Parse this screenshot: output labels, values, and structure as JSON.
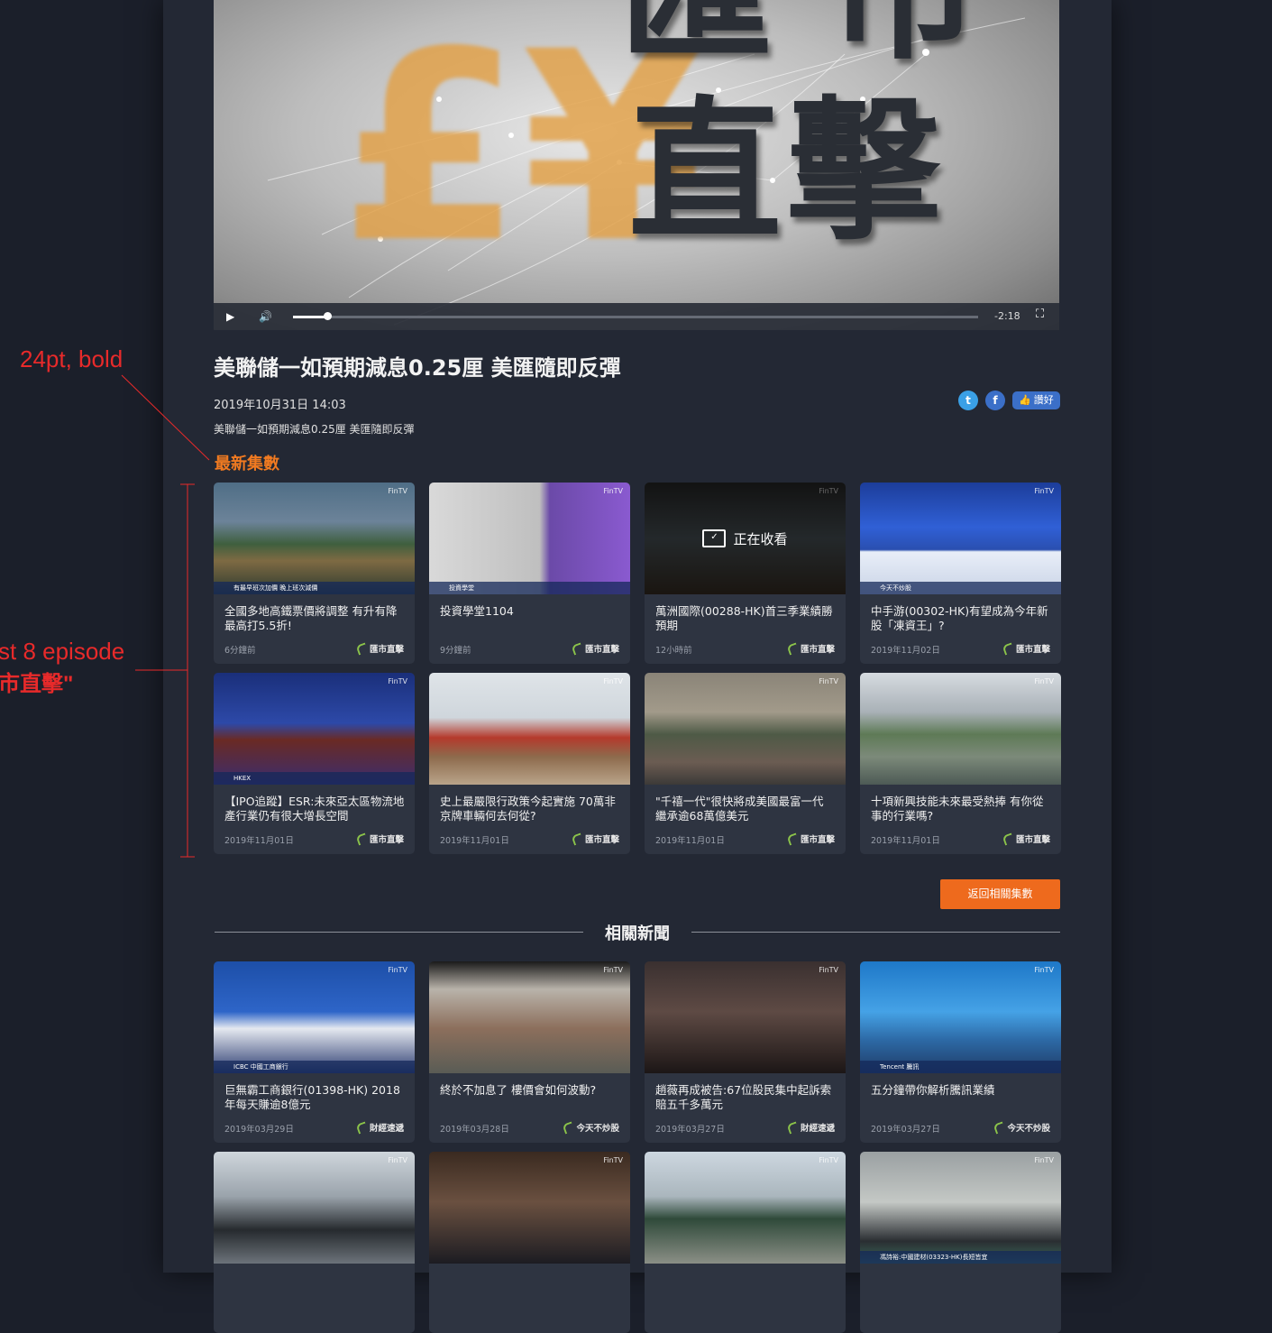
{
  "video": {
    "headline_top": "匯市",
    "headline_bottom": "直擊",
    "currency_symbol": "£¥",
    "time": "-2:18",
    "progress": 0.05
  },
  "article": {
    "title": "美聯儲一如預期減息0.25厘 美匯隨即反彈",
    "date": "2019年10月31日 14:03",
    "description": "美聯儲一如預期減息0.25厘 美匯隨即反彈",
    "like_label": "讚好"
  },
  "latest": {
    "heading": "最新集數",
    "items": [
      {
        "title": "全國多地高鐵票價將調整 有升有降最高打5.5折!",
        "time": "6分鐘前",
        "program": "匯市直擊",
        "thumb_text": "有最早班次加價 晚上班次減價"
      },
      {
        "title": "投資學堂1104",
        "time": "9分鐘前",
        "program": "匯市直擊",
        "thumb_text": "投資學堂"
      },
      {
        "title": "萬洲國際(00288-HK)首三季業績勝預期",
        "time": "12小時前",
        "program": "匯市直擊",
        "now_playing": "正在收看"
      },
      {
        "title": "中手游(00302-HK)有望成為今年新股「凍資王」?",
        "time": "2019年11月02日",
        "program": "匯市直擊",
        "thumb_text": "今天不炒股"
      },
      {
        "title": "【IPO追蹤】ESR:未來亞太區物流地產行業仍有很大增長空間",
        "time": "2019年11月01日",
        "program": "匯市直擊",
        "thumb_text": "HKEX"
      },
      {
        "title": "史上最嚴限行政策今起實施 70萬非京牌車輛何去何從?",
        "time": "2019年11月01日",
        "program": "匯市直擊",
        "thumb_text": ""
      },
      {
        "title": "\"千禧一代\"很快將成美國最富一代 繼承逾68萬億美元",
        "time": "2019年11月01日",
        "program": "匯市直擊",
        "thumb_text": ""
      },
      {
        "title": "十項新興技能未來最受熱捧 有你從事的行業嗎?",
        "time": "2019年11月01日",
        "program": "匯市直擊",
        "thumb_text": ""
      }
    ],
    "back_button": "返回相關集數"
  },
  "related": {
    "heading": "相關新聞",
    "items": [
      {
        "title": "巨無霸工商銀行(01398-HK) 2018年每天賺逾8億元",
        "time": "2019年03月29日",
        "program": "財經速遞",
        "thumb_text": "ICBC 中國工商銀行"
      },
      {
        "title": "終於不加息了 樓價會如何波動?",
        "time": "2019年03月28日",
        "program": "今天不炒股",
        "thumb_text": ""
      },
      {
        "title": "趙薇再成被告:67位股民集中起訴索賠五千多萬元",
        "time": "2019年03月27日",
        "program": "財經速遞",
        "thumb_text": ""
      },
      {
        "title": "五分鐘帶你解析騰訊業績",
        "time": "2019年03月27日",
        "program": "今天不炒股",
        "thumb_text": "Tencent 騰訊"
      },
      {
        "title": "",
        "time": "",
        "program": "",
        "thumb_text": ""
      },
      {
        "title": "",
        "time": "",
        "program": "",
        "thumb_text": ""
      },
      {
        "title": "",
        "time": "",
        "program": "",
        "thumb_text": ""
      },
      {
        "title": "",
        "time": "",
        "program": "",
        "thumb_text": "馮詩裕:中國建材(03323-HK)長短皆宜"
      }
    ]
  },
  "annotations": {
    "font_note": "24pt, bold",
    "episodes_note_line1": "st 8 episode",
    "episodes_note_line2": "市直擊\""
  },
  "colors": {
    "accent": "#f07a21",
    "button": "#ee6a1d",
    "annotation": "#e82a2a",
    "card": "#2e3441"
  }
}
